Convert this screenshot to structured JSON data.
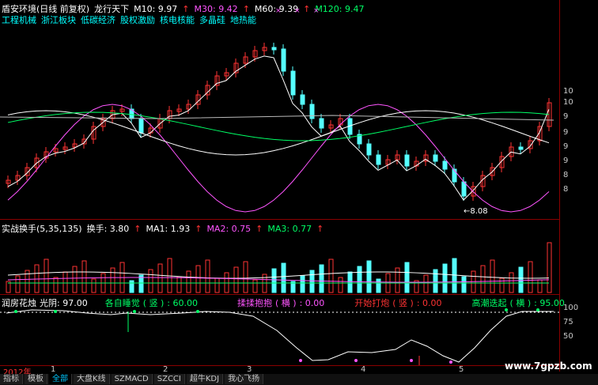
{
  "header": {
    "title": "盾安环境(日线 前复权)",
    "indicator_name": "龙行天下",
    "ma": [
      {
        "label": "M10: 9.97",
        "color": "#ffffff"
      },
      {
        "label": "M30: 9.42",
        "color": "#ff55ff"
      },
      {
        "label": "M60: 9.39",
        "color": "#ffffff"
      },
      {
        "label": "M120: 9.47",
        "color": "#00ff66"
      }
    ],
    "concepts": [
      "工程机械",
      "浙江板块",
      "低碳经济",
      "股权激励",
      "核电核能",
      "多晶硅",
      "地热能"
    ]
  },
  "main_chart": {
    "low_label": "8.08",
    "y_ticks": [
      "10",
      "10",
      "9",
      "9",
      "9",
      "9",
      "8",
      "8"
    ]
  },
  "volume": {
    "title": "实战换手(5,35,135)",
    "turnover": "换手: 3.80",
    "ma1": "MA1: 1.93",
    "ma2": "MA2: 0.75",
    "ma3": "MA3: 0.77",
    "colors": {
      "up": "#ff3333",
      "down": "#55ffff",
      "ma2": "#ff55ff",
      "ma3": "#00ff66"
    }
  },
  "oscillator": {
    "title": "润房花烛",
    "light": "光阴: 97.00",
    "sleep": "各自睡觉",
    "sleep_tag": "( 竖 )",
    "sleep_value": ": 60.00",
    "hold": "揉揉抱抱",
    "hold_tag": "( 横 )",
    "hold_value": ": 0.00",
    "fire": "开始打炮",
    "fire_tag": "( 竖 )",
    "fire_value": ": 0.00",
    "climax": "高潮迭起",
    "climax_tag": "( 横 )",
    "climax_value": ": 95.00",
    "y_ticks": [
      "100",
      "75",
      "50"
    ]
  },
  "date_axis": {
    "year": "2012年",
    "months": [
      "1",
      "2",
      "3",
      "4",
      "5"
    ]
  },
  "tabs": [
    "指标",
    "模板",
    "全部",
    "大盘K线",
    "SZMACD",
    "SZCCI",
    "超牛KDJ",
    "我心飞扬"
  ],
  "active_tab": "全部",
  "watermark": "www.7gpzb.com"
}
